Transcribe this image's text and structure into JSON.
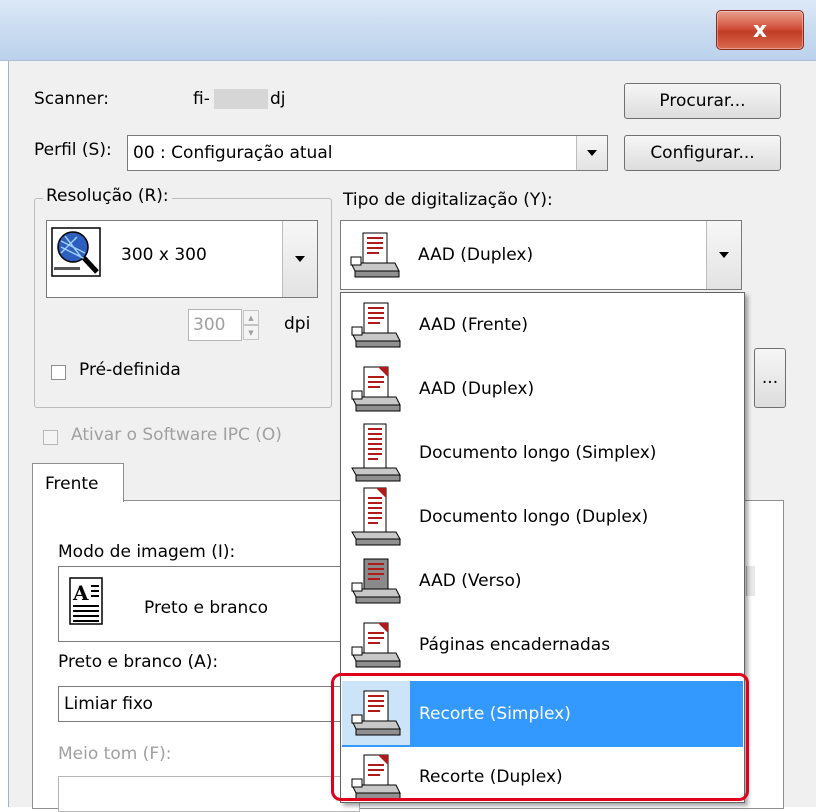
{
  "window": {
    "close_label": "x",
    "accent_close": "#c13d25"
  },
  "scanner": {
    "label": "Scanner:",
    "value_prefix": "fi-",
    "value_suffix": "dj",
    "browse_button": "Procurar..."
  },
  "profile": {
    "label": "Perfil (S):",
    "value": "00 : Configuração atual",
    "configure_button": "Configurar..."
  },
  "resolution": {
    "group_label": "Resolução (R):",
    "value": "300 x 300",
    "dpi_value": "300",
    "dpi_unit": "dpi",
    "predefined_label": "Pré-definida"
  },
  "scan_type": {
    "label": "Tipo de digitalização (Y):",
    "selected": "AAD (Duplex)",
    "more_button": "...",
    "options": [
      {
        "label": "AAD (Frente)",
        "icon": "adf-front-icon"
      },
      {
        "label": "AAD (Duplex)",
        "icon": "adf-duplex-icon"
      },
      {
        "label": "Documento longo (Simplex)",
        "icon": "long-document-simplex-icon"
      },
      {
        "label": "Documento longo (Duplex)",
        "icon": "long-document-duplex-icon"
      },
      {
        "label": "AAD (Verso)",
        "icon": "adf-back-icon"
      },
      {
        "label": "Páginas encadernadas",
        "icon": "bound-pages-icon"
      },
      {
        "label": "Recorte (Simplex)",
        "icon": "carrier-simplex-icon",
        "selected": true
      },
      {
        "label": "Recorte (Duplex)",
        "icon": "carrier-duplex-icon"
      }
    ],
    "highlight_color": "#e0001b",
    "selection_color": "#3399ff"
  },
  "ipc": {
    "label": "Ativar o Software IPC (O)"
  },
  "tabs": {
    "front_label": "Frente"
  },
  "image_mode": {
    "label": "Modo de imagem (I):",
    "value": "Preto e branco"
  },
  "bw": {
    "label": "Preto e branco (A):",
    "value": "Limiar fixo"
  },
  "halftone": {
    "label": "Meio tom (F):"
  }
}
